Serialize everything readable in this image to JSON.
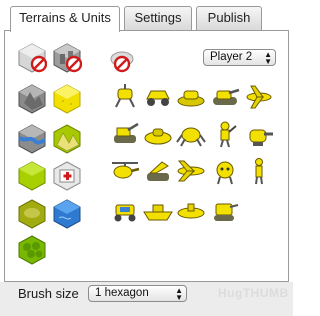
{
  "tabs": [
    {
      "label": "Terrains & Units",
      "active": true
    },
    {
      "label": "Settings",
      "active": false
    },
    {
      "label": "Publish",
      "active": false
    }
  ],
  "player_select": {
    "value": "Player 2"
  },
  "brush": {
    "label": "Brush size",
    "value": "1 hexagon"
  },
  "watermark": "HugTHUMB",
  "colors": {
    "accent": "#f2e000",
    "green": "#a8d000",
    "water": "#3a7fd1",
    "erase": "#d01b1b"
  },
  "terrains": [
    "erase-terrain-icon",
    "city-gray-tile-icon",
    "mountain-tile-icon",
    "plain-tile-icon",
    "river-tile-icon",
    "mountains-green-tile-icon",
    "grassland-tile-icon",
    "hospital-tile-icon",
    "swamp-tile-icon",
    "lake-tile-icon",
    "forest-tile-icon"
  ],
  "units": [
    "erase-unit-icon",
    "walker-unit-icon",
    "buggy-unit-icon",
    "hovercraft-unit-icon",
    "tank-unit-icon",
    "plane-unit-icon",
    "artillery-unit-icon",
    "hover-tank-unit-icon",
    "crab-unit-icon",
    "soldier-unit-icon",
    "turret-unit-icon",
    "helicopter-unit-icon",
    "launcher-unit-icon",
    "jet-unit-icon",
    "droid-unit-icon",
    "trooper-unit-icon",
    "rover-unit-icon",
    "boat-unit-icon",
    "submarine-unit-icon",
    "mech-unit-icon"
  ]
}
